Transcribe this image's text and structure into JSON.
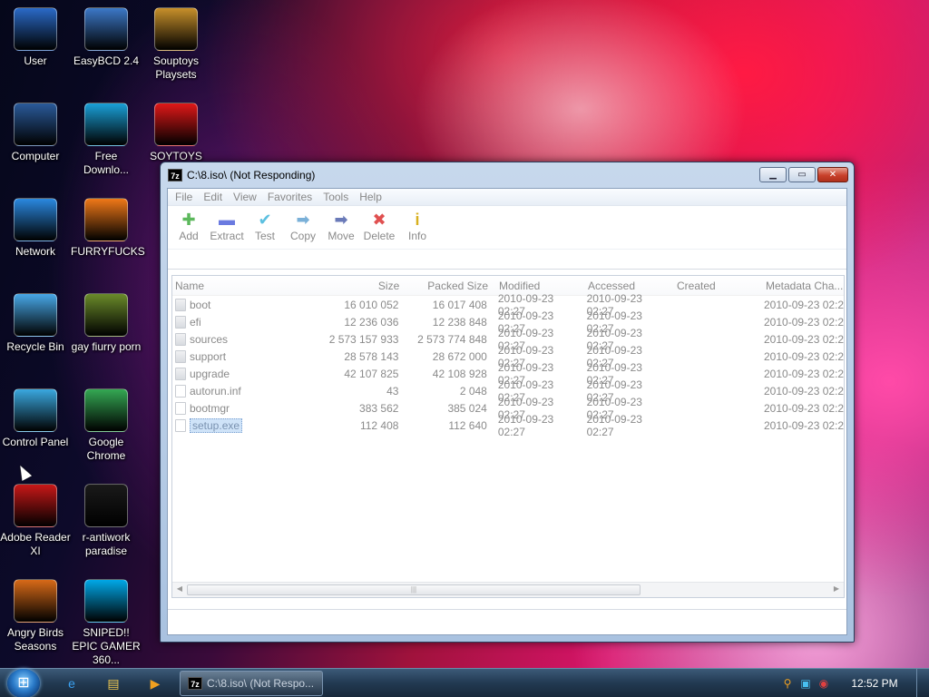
{
  "desktop": {
    "icons": [
      {
        "label": "User",
        "icon": "user-folder-icon",
        "color": "#2a6ac8"
      },
      {
        "label": "EasyBCD 2.4",
        "icon": "easybcd-icon",
        "color": "#3c78c8"
      },
      {
        "label": "Souptoys Playsets",
        "icon": "souptoys-icon",
        "color": "#c8902a"
      },
      {
        "label": "Computer",
        "icon": "computer-icon",
        "color": "#2a5a9a"
      },
      {
        "label": "Free Downlo...",
        "icon": "free-download-manager-icon",
        "color": "#1aa0d8"
      },
      {
        "label": "SOYTOYS",
        "icon": "soytoys-icon",
        "color": "#e01818"
      },
      {
        "label": "Network",
        "icon": "network-icon",
        "color": "#2a88e0"
      },
      {
        "label": "FURRYFUCKS",
        "icon": "firefox-icon",
        "color": "#f07818"
      },
      {
        "label": "Recycle Bin",
        "icon": "recycle-bin-icon",
        "color": "#48a8e8"
      },
      {
        "label": "gay fiurry porn",
        "icon": "box-image-icon",
        "color": "#6a8a2a"
      },
      {
        "label": "Control Panel",
        "icon": "control-panel-icon",
        "color": "#3aa8e0"
      },
      {
        "label": "Google Chrome",
        "icon": "chrome-icon",
        "color": "#34a853"
      },
      {
        "label": "Adobe Reader XI",
        "icon": "adobe-reader-icon",
        "color": "#c81818"
      },
      {
        "label": "r-antiwork paradise",
        "icon": "r-antiwork-icon",
        "color": "#1a1a1a"
      },
      {
        "label": "Angry Birds Seasons",
        "icon": "angry-birds-icon",
        "color": "#d86a18"
      },
      {
        "label": "SNIPED!! EPIC GAMER 360...",
        "icon": "skype-icon",
        "color": "#00a8e8"
      }
    ]
  },
  "window": {
    "app_badge": "7z",
    "title": "C:\\8.iso\\ (Not Responding)",
    "menu": [
      "File",
      "Edit",
      "View",
      "Favorites",
      "Tools",
      "Help"
    ],
    "toolbar": [
      {
        "label": "Add",
        "glyph": "✚",
        "color": "#5cb85c"
      },
      {
        "label": "Extract",
        "glyph": "▬",
        "color": "#6a7ae0"
      },
      {
        "label": "Test",
        "glyph": "✔",
        "color": "#5cc0e0"
      },
      {
        "label": "Copy",
        "glyph": "➡",
        "color": "#7ab0d8"
      },
      {
        "label": "Move",
        "glyph": "➡",
        "color": "#6a7ab8"
      },
      {
        "label": "Delete",
        "glyph": "✖",
        "color": "#e05050"
      },
      {
        "label": "Info",
        "glyph": "i",
        "color": "#d8b020"
      }
    ],
    "columns": [
      "Name",
      "Size",
      "Packed Size",
      "Modified",
      "Accessed",
      "Created",
      "Metadata Cha..."
    ],
    "rows": [
      {
        "name": "boot",
        "type": "folder",
        "size": "16 010 052",
        "packed": "16 017 408",
        "modified": "2010-09-23 02:27",
        "accessed": "2010-09-23 02:27",
        "created": "",
        "meta": "2010-09-23 02:2"
      },
      {
        "name": "efi",
        "type": "folder",
        "size": "12 236 036",
        "packed": "12 238 848",
        "modified": "2010-09-23 02:27",
        "accessed": "2010-09-23 02:27",
        "created": "",
        "meta": "2010-09-23 02:2"
      },
      {
        "name": "sources",
        "type": "folder",
        "size": "2 573 157 933",
        "packed": "2 573 774 848",
        "modified": "2010-09-23 02:27",
        "accessed": "2010-09-23 02:27",
        "created": "",
        "meta": "2010-09-23 02:2"
      },
      {
        "name": "support",
        "type": "folder",
        "size": "28 578 143",
        "packed": "28 672 000",
        "modified": "2010-09-23 02:27",
        "accessed": "2010-09-23 02:27",
        "created": "",
        "meta": "2010-09-23 02:2"
      },
      {
        "name": "upgrade",
        "type": "folder",
        "size": "42 107 825",
        "packed": "42 108 928",
        "modified": "2010-09-23 02:27",
        "accessed": "2010-09-23 02:27",
        "created": "",
        "meta": "2010-09-23 02:2"
      },
      {
        "name": "autorun.inf",
        "type": "file",
        "size": "43",
        "packed": "2 048",
        "modified": "2010-09-23 02:27",
        "accessed": "2010-09-23 02:27",
        "created": "",
        "meta": "2010-09-23 02:2"
      },
      {
        "name": "bootmgr",
        "type": "file",
        "size": "383 562",
        "packed": "385 024",
        "modified": "2010-09-23 02:27",
        "accessed": "2010-09-23 02:27",
        "created": "",
        "meta": "2010-09-23 02:2"
      },
      {
        "name": "setup.exe",
        "type": "file",
        "size": "112 408",
        "packed": "112 640",
        "modified": "2010-09-23 02:27",
        "accessed": "2010-09-23 02:27",
        "created": "",
        "meta": "2010-09-23 02:2",
        "selected": true
      }
    ]
  },
  "taskbar": {
    "start_glyph": "⊞",
    "pinned": [
      {
        "name": "internet-explorer-icon",
        "glyph": "e",
        "color": "#3aa0f0"
      },
      {
        "name": "explorer-folder-icon",
        "glyph": "▤",
        "color": "#f0c850"
      },
      {
        "name": "media-player-icon",
        "glyph": "▶",
        "color": "#f0a020"
      }
    ],
    "task_badge": "7z",
    "task_label": "C:\\8.iso\\ (Not Respo...",
    "clock": "12:52 PM"
  }
}
